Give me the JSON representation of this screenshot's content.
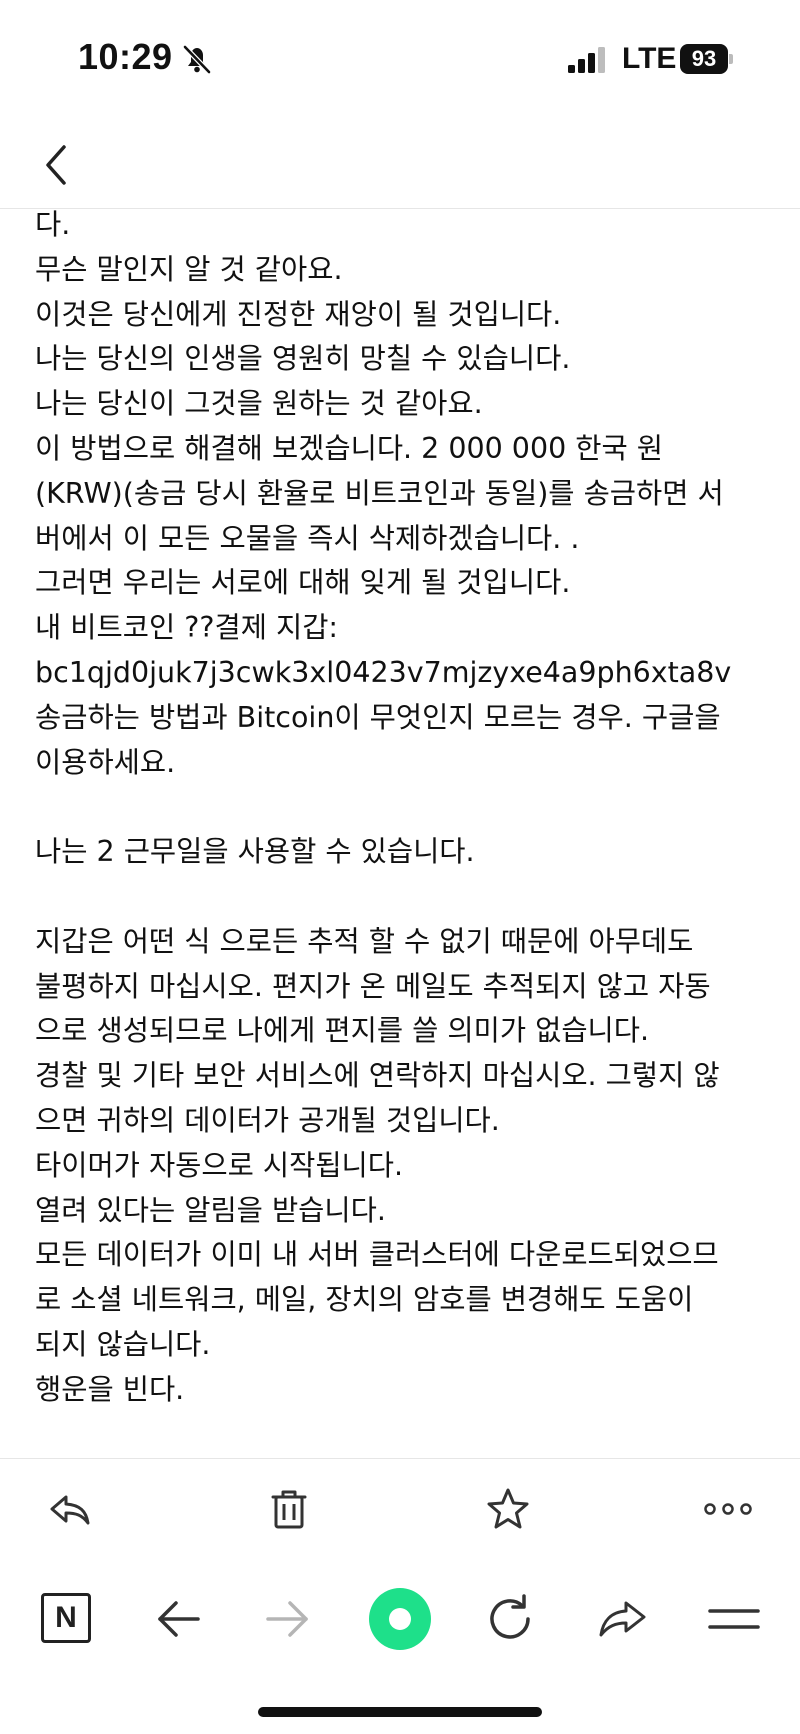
{
  "status_bar": {
    "time": "10:29",
    "network": "LTE",
    "battery": "93",
    "icons": [
      "bell-slash-icon",
      "signal-icon",
      "battery-icon"
    ]
  },
  "header": {
    "back_icon": "chevron-left-icon"
  },
  "mail": {
    "lines": [
      "다.",
      "무슨 말인지 알 것 같아요.",
      "이것은 당신에게 진정한 재앙이 될 것입니다.",
      "나는 당신의 인생을 영원히 망칠 수 있습니다.",
      "나는 당신이 그것을 원하는 것 같아요.",
      "이 방법으로 해결해 보겠습니다. 2 000 000 한국 원",
      "(KRW)(송금 당시 환율로 비트코인과 동일)를 송금하면 서",
      "버에서 이 모든 오물을 즉시 삭제하겠습니다. .",
      "그러면 우리는 서로에 대해 잊게 될 것입니다.",
      "내 비트코인 ??결제 지갑:",
      "bc1qjd0juk7j3cwk3xl0423v7mjzyxe4a9ph6xta8v",
      "송금하는 방법과 Bitcoin이 무엇인지 모르는 경우. 구글을",
      "이용하세요.",
      "",
      "나는 2 근무일을 사용할 수 있습니다.",
      "",
      "지갑은 어떤 식 으로든 추적 할 수 없기 때문에 아무데도",
      "불평하지 마십시오. 편지가 온 메일도 추적되지 않고 자동",
      "으로 생성되므로 나에게 편지를 쓸 의미가 없습니다.",
      "경찰 및 기타 보안 서비스에 연락하지 마십시오. 그렇지 않",
      "으면 귀하의 데이터가 공개될 것입니다.",
      "타이머가 자동으로 시작됩니다.",
      "열려 있다는 알림을 받습니다.",
      "모든 데이터가 이미 내 서버 클러스터에 다운로드되었으므",
      "로 소셜 네트워크, 메일, 장치의 암호를 변경해도 도움이",
      "되지 않습니다.",
      "행운을 빈다."
    ]
  },
  "toolbar": {
    "icons": [
      "reply-icon",
      "trash-icon",
      "star-icon",
      "more-icon"
    ]
  },
  "browser_bar": {
    "logo_letter": "N",
    "icons": [
      "naver-logo-icon",
      "arrow-left-icon",
      "arrow-right-icon",
      "green-dot-icon",
      "refresh-icon",
      "share-icon",
      "menu-icon"
    ],
    "accent": "#1ee08a"
  }
}
